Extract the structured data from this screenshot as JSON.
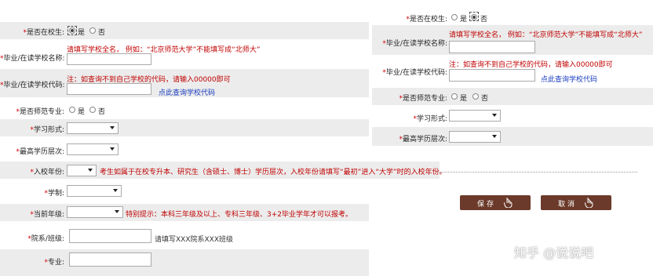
{
  "left": {
    "in_school": {
      "label": "是否在校生:",
      "options": [
        "是",
        "否"
      ],
      "selected": "是"
    },
    "school_name": {
      "label": "毕业/在读学校名称:",
      "hint": "请填写学校全名，  例如：“北京师范大学”不能填写成“北师大”",
      "value": ""
    },
    "school_code": {
      "label": "毕业/在读学校代码:",
      "hint": "注：如查询不到自己学校的代码，请输入00000即可",
      "value": "",
      "link": "点此查询学校代码"
    },
    "normal_major": {
      "label": "是否师范专业:",
      "options": [
        "是",
        "否"
      ],
      "selected": ""
    },
    "study_form": {
      "label": "学习形式:",
      "value": ""
    },
    "highest_edu": {
      "label": "最高学历层次:",
      "value": ""
    },
    "enroll_year": {
      "label": "入校年份:",
      "value": "",
      "hint": "考生如属于在校专升本、研究生（含硕士、博士）学历层次，入校年份请填写“最初”进入“大学”时的入校年份。"
    },
    "duration": {
      "label": "学制:",
      "value": ""
    },
    "grade": {
      "label": "当前年级:",
      "value": "",
      "hint": "特别提示：本科三年级及以上、专科三年级、3+2毕业学年才可以报考。"
    },
    "dept_class": {
      "label": "院系/班级:",
      "value": "",
      "hint": "请填写XXX院系XXX班级"
    },
    "major": {
      "label": "专业:",
      "value": ""
    }
  },
  "right": {
    "in_school": {
      "label": "是否在校生:",
      "options": [
        "是",
        "否"
      ],
      "selected": "否"
    },
    "school_name": {
      "label": "毕业/在读学校名称:",
      "hint": "请填写学校全名，  例如：“北京师范大学”不能填写成“北师大”",
      "value": ""
    },
    "school_code": {
      "label": "毕业/在读学校代码:",
      "hint": "注：如查询不到自己学校的代码，请输入00000即可",
      "value": "",
      "link": "点此查询学校代码"
    },
    "normal_major": {
      "label": "是否师范专业:",
      "options": [
        "是",
        "否"
      ],
      "selected": ""
    },
    "study_form": {
      "label": "学习形式:",
      "value": ""
    },
    "highest_edu": {
      "label": "最高学历层次:",
      "value": ""
    }
  },
  "buttons": {
    "save": "保存",
    "cancel": "取消"
  },
  "watermark": "知乎 @说说吧",
  "colors": {
    "required": "#d00000",
    "hint": "#c00000",
    "link": "#1a3cc0",
    "button": "#6b3a2a",
    "row_shade": "#ececec"
  }
}
